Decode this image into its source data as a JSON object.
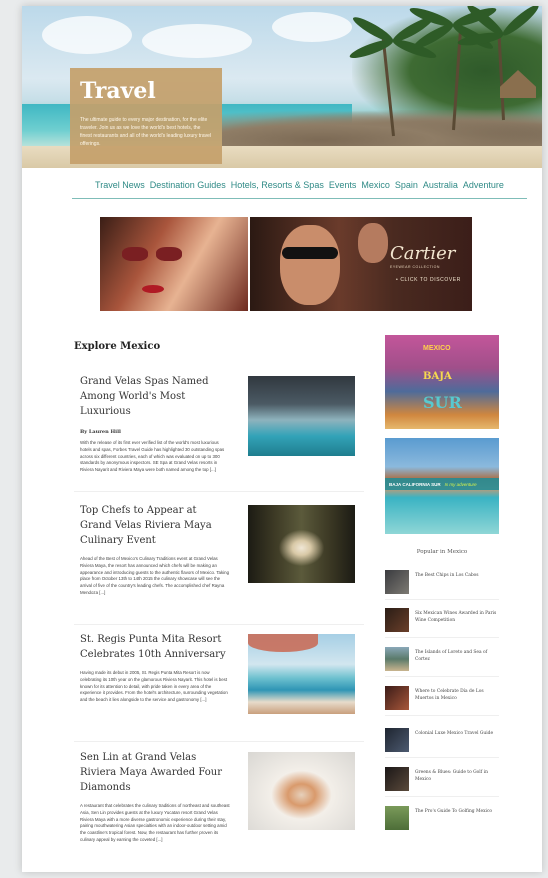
{
  "hero": {
    "title": "Travel",
    "description": "The ultimate guide to every major destination, for the elite traveler. Join us as we love the world's best hotels, the finest restaurants and all of the world's leading luxury travel offerings."
  },
  "nav": {
    "items": [
      "Travel News",
      "Destination Guides",
      "Hotels, Resorts & Spas",
      "Events",
      "Mexico",
      "Spain",
      "Australia",
      "Adventure"
    ]
  },
  "ad_banner": {
    "brand": "Cartier",
    "tagline": "EYEWEAR COLLECTION",
    "cta": "• CLICK TO DISCOVER"
  },
  "section": {
    "title": "Explore Mexico"
  },
  "articles": [
    {
      "title": "Grand Velas Spas Named Among World's Most Luxurious",
      "author": "By Lauren Hill",
      "excerpt": "With the release of its first ever verified list of the world's most luxurious hotels and spas, Forbes Travel Guide has highlighted 30 outstanding spas across six different countries, each of which was evaluated on up to 300 standards by anonymous inspectors. SE Spa at Grand Velas resorts in Riviera Nayarit and Riviera Maya were both named among the top [...]"
    },
    {
      "title": "Top Chefs to Appear at Grand Velas Riviera Maya Culinary Event",
      "author": "",
      "excerpt": "Ahead of the Best of Mexico's Culinary Traditions event at Grand Velas Riviera Maya, the resort has announced which chefs will be making an appearance and introducing guests to the authentic flavors of Mexico. Taking place from October 13th to 14th 2015 the culinary showcase will see the arrival of five of the country's leading chefs. The accomplished chef Rayna Mendoza [...]"
    },
    {
      "title": "St. Regis Punta Mita Resort Celebrates 10th Anniversary",
      "author": "",
      "excerpt": "Having made its debut in 2005, St. Regis Punta Mita Resort is now celebrating its 10th year on the glamorous Riviera Nayarit. This hotel is best known for its attention to detail, with pride taken in every area of the experience it provides. From the hotel's architecture, surrounding vegetation and the beach it lies alongside to the service and gastronomy [...]"
    },
    {
      "title": "Sen Lin at Grand Velas Riviera Maya Awarded Four Diamonds",
      "author": "",
      "excerpt": "A restaurant that celebrates the culinary traditions of northeast and southeast Asia, Sen Lin provides guests at the luxury Yucatan resort Grand Velas Riviera Maya with a more diverse gastronomic experience during their stay, pairing mouthwatering Asian specialties with an indoor-outdoor setting amid the coastline's tropical forest. Now, the restaurant has further proven its culinary appeal by earning the coveted [...]"
    }
  ],
  "sidebar": {
    "ad1": {
      "kicker": "MEXICO",
      "logo_line1": "BAJA",
      "logo_line2": "SUR"
    },
    "ad2": {
      "caption": "BAJA CALIFORNIA SUR",
      "caption_tag": "Is my adventure"
    },
    "popular_title": "Popular in Mexico",
    "popular": [
      "The Best Chips in Los Cabos",
      "Six Mexican Wines Awarded in Paris Wine Competition",
      "The Islands of Loreto and Sea of Cortez",
      "Where to Celebrate Día de Los Muertos in Mexico",
      "Colonial Luxe Mexico Travel Guide",
      "Greens & Blues: Guide to Golf in Mexico",
      "The Pro's Guide To Golfing Mexico"
    ]
  },
  "colors": {
    "accent": "#2f8a86",
    "hero_card": "#c4a06a"
  }
}
